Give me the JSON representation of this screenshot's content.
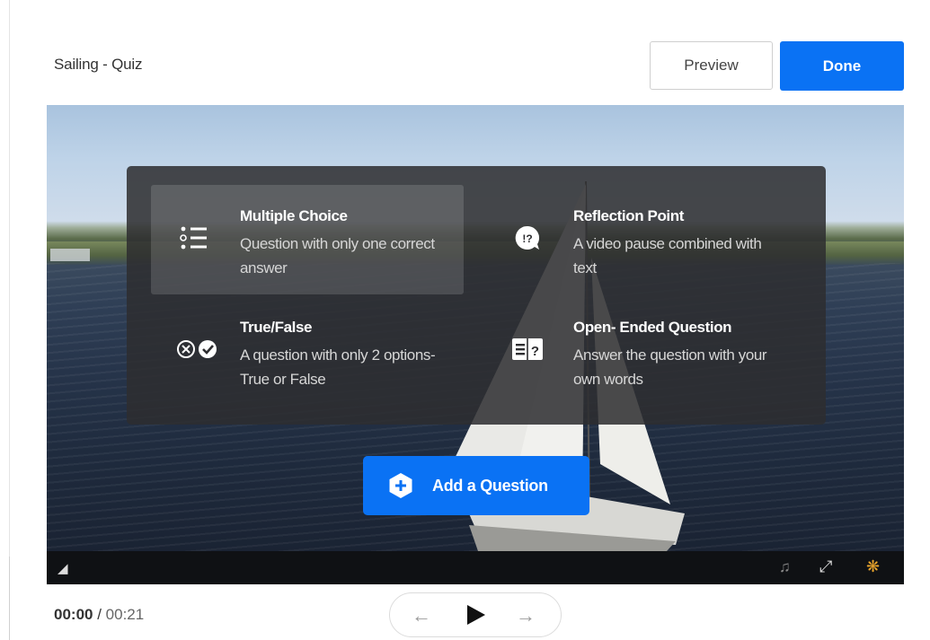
{
  "page": {
    "title": "Sailing - Quiz"
  },
  "header": {
    "preview_label": "Preview",
    "done_label": "Done"
  },
  "question_types": [
    {
      "id": "multiple-choice",
      "title": "Multiple Choice",
      "description": "Question with only one correct answer",
      "icon": "list-icon",
      "selected": true
    },
    {
      "id": "reflection-point",
      "title": "Reflection Point",
      "description": "A video pause combined with text",
      "icon": "reflection-icon",
      "selected": false
    },
    {
      "id": "true-false",
      "title": "True/False",
      "description": "A question with only 2 options- True or False",
      "icon": "true-false-icon",
      "selected": false
    },
    {
      "id": "open-ended",
      "title": "Open- Ended Question",
      "description": "Answer the question with your own words",
      "icon": "open-ended-icon",
      "selected": false
    }
  ],
  "add_question": {
    "label": "Add a Question",
    "icon": "plus-hex-icon"
  },
  "player": {
    "current_time": "00:00",
    "separator": " / ",
    "total_time": "00:21"
  },
  "colors": {
    "accent": "#0a72f4",
    "overlay": "#2d2d30"
  }
}
